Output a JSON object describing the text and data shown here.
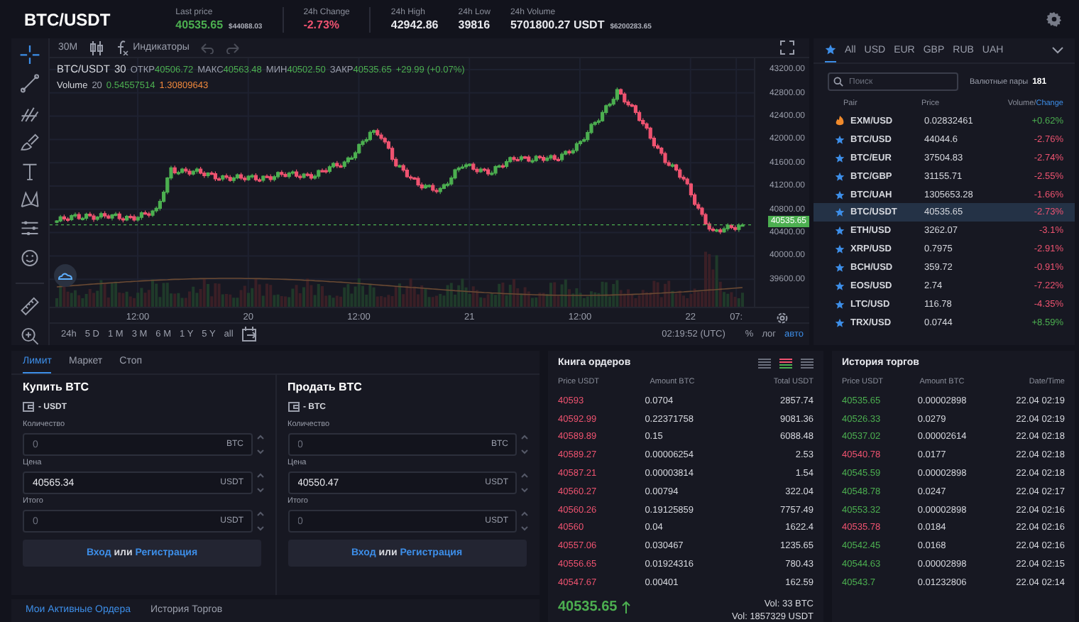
{
  "header": {
    "title": "BTC/USDT",
    "stats": [
      {
        "label": "Last price",
        "value": "40535.65",
        "color": "#4caf50",
        "sub": "$44088.03"
      },
      {
        "label": "24h Change",
        "value": "-2.73%",
        "color": "#ef5370"
      },
      {
        "label": "24h High",
        "value": "42942.86",
        "color": "#e8e9ee"
      },
      {
        "label": "24h Low",
        "value": "39816",
        "color": "#e8e9ee"
      },
      {
        "label": "24h Volume",
        "value": "5701800.27 USDT",
        "color": "#e8e9ee",
        "sub": "$6200283.65"
      }
    ]
  },
  "chart": {
    "interval": "30M",
    "indicators_label": "Индикаторы",
    "legend": {
      "symbol": "BTC/USDT",
      "interval": "30",
      "ohlc": [
        {
          "label": "ОТКР",
          "value": "40506.72"
        },
        {
          "label": "МАКС",
          "value": "40563.48"
        },
        {
          "label": "МИН",
          "value": "40502.50"
        },
        {
          "label": "ЗАКР",
          "value": "40535.65"
        }
      ],
      "change": "+29.99 (+0.07%)"
    },
    "volume_legend": {
      "label": "Volume",
      "period": "20",
      "value": "0.54557514",
      "average": "1.30809643"
    },
    "y_axis": [
      "43200.00",
      "42800.00",
      "42400.00",
      "42000.00",
      "41600.00",
      "41200.00",
      "40800.00",
      "40400.00",
      "40000.00",
      "39600.00"
    ],
    "price_tag": "40535.65",
    "x_axis": [
      "12:00",
      "20",
      "12:00",
      "21",
      "12:00",
      "22",
      "07:"
    ],
    "ranges": [
      "24h",
      "5 D",
      "1 M",
      "3 M",
      "6 M",
      "1 Y",
      "5 Y",
      "all"
    ],
    "clock": "02:19:52 (UTC)",
    "scale_options": [
      {
        "label": "%",
        "selected": false
      },
      {
        "label": "лог",
        "selected": false
      },
      {
        "label": "авто",
        "selected": true
      }
    ]
  },
  "market": {
    "tabs": [
      {
        "kind": "star",
        "selected": true
      },
      {
        "kind": "text",
        "label": "All",
        "selected": false
      },
      {
        "kind": "text",
        "label": "USD",
        "selected": false
      },
      {
        "kind": "text",
        "label": "EUR",
        "selected": false
      },
      {
        "kind": "text",
        "label": "GBP",
        "selected": false
      },
      {
        "kind": "text",
        "label": "RUB",
        "selected": false
      },
      {
        "kind": "text",
        "label": "UAH",
        "selected": false
      }
    ],
    "search": {
      "placeholder": "Поиск"
    },
    "pairs_label": "Валютные пары",
    "pairs_count": "181",
    "columns": {
      "pair": "Pair",
      "price": "Price",
      "volume": "Volume/",
      "change": "Change"
    },
    "rows": [
      {
        "kind": "hot",
        "pair": "EXM/USD",
        "price": "0.02832461",
        "change": "+0.62%",
        "color": "#4caf50",
        "selected": false
      },
      {
        "kind": "favorite",
        "pair": "BTC/USD",
        "price": "44044.6",
        "change": "-2.76%",
        "color": "#ef5370",
        "selected": false
      },
      {
        "kind": "favorite",
        "pair": "BTC/EUR",
        "price": "37504.83",
        "change": "-2.74%",
        "color": "#ef5370",
        "selected": false
      },
      {
        "kind": "favorite",
        "pair": "BTC/GBP",
        "price": "31155.71",
        "change": "-2.55%",
        "color": "#ef5370",
        "selected": false
      },
      {
        "kind": "favorite",
        "pair": "BTC/UAH",
        "price": "1305653.28",
        "change": "-1.66%",
        "color": "#ef5370",
        "selected": false
      },
      {
        "kind": "favorite",
        "pair": "BTC/USDT",
        "price": "40535.65",
        "change": "-2.73%",
        "color": "#ef5370",
        "selected": true
      },
      {
        "kind": "favorite",
        "pair": "ETH/USD",
        "price": "3262.07",
        "change": "-3.1%",
        "color": "#ef5370",
        "selected": false
      },
      {
        "kind": "favorite",
        "pair": "XRP/USD",
        "price": "0.7975",
        "change": "-2.91%",
        "color": "#ef5370",
        "selected": false
      },
      {
        "kind": "favorite",
        "pair": "BCH/USD",
        "price": "359.72",
        "change": "-0.91%",
        "color": "#ef5370",
        "selected": false
      },
      {
        "kind": "favorite",
        "pair": "EOS/USD",
        "price": "2.74",
        "change": "-7.22%",
        "color": "#ef5370",
        "selected": false
      },
      {
        "kind": "favorite",
        "pair": "LTC/USD",
        "price": "116.78",
        "change": "-4.35%",
        "color": "#ef5370",
        "selected": false
      },
      {
        "kind": "favorite",
        "pair": "TRX/USD",
        "price": "0.0744",
        "change": "+8.59%",
        "color": "#4caf50",
        "selected": false
      }
    ]
  },
  "order_form": {
    "tabs": [
      {
        "label": "Лимит",
        "selected": true
      },
      {
        "label": "Маркет",
        "selected": false
      },
      {
        "label": "Стоп",
        "selected": false
      }
    ],
    "sides": [
      {
        "title": "Купить BTC",
        "balance": "- USDT",
        "fields": [
          {
            "label": "Количество",
            "placeholder": "0",
            "unit": "BTC"
          },
          {
            "label": "Цена",
            "value": "40565.34",
            "unit": "USDT"
          },
          {
            "label": "Итого",
            "placeholder": "0",
            "unit": "USDT"
          }
        ],
        "button": {
          "login": "Вход",
          "joiner": "или",
          "register": "Регистрация"
        }
      },
      {
        "title": "Продать BTC",
        "balance": "- BTC",
        "fields": [
          {
            "label": "Количество",
            "placeholder": "0",
            "unit": "BTC"
          },
          {
            "label": "Цена",
            "value": "40550.47",
            "unit": "USDT"
          },
          {
            "label": "Итого",
            "placeholder": "0",
            "unit": "USDT"
          }
        ],
        "button": {
          "login": "Вход",
          "joiner": "или",
          "register": "Регистрация"
        }
      }
    ]
  },
  "bottom_tabs": [
    {
      "label": "Мои Активные Ордера",
      "selected": true
    },
    {
      "label": "История Торгов",
      "selected": false
    }
  ],
  "order_book": {
    "title": "Книга ордеров",
    "views": [
      {
        "kind": "bids",
        "selected": false
      },
      {
        "kind": "both",
        "selected": true
      },
      {
        "kind": "asks",
        "selected": false
      }
    ],
    "columns": [
      "Price USDT",
      "Amount BTC",
      "Total USDT"
    ],
    "rows": [
      {
        "color": "#ef5370",
        "price": "40593",
        "amount": "0.0704",
        "total": "2857.74"
      },
      {
        "color": "#ef5370",
        "price": "40592.99",
        "amount": "0.22371758",
        "total": "9081.36"
      },
      {
        "color": "#ef5370",
        "price": "40589.89",
        "amount": "0.15",
        "total": "6088.48"
      },
      {
        "color": "#ef5370",
        "price": "40589.27",
        "amount": "0.00006254",
        "total": "2.53"
      },
      {
        "color": "#ef5370",
        "price": "40587.21",
        "amount": "0.00003814",
        "total": "1.54"
      },
      {
        "color": "#ef5370",
        "price": "40560.27",
        "amount": "0.00794",
        "total": "322.04"
      },
      {
        "color": "#ef5370",
        "price": "40560.26",
        "amount": "0.19125859",
        "total": "7757.49"
      },
      {
        "color": "#ef5370",
        "price": "40560",
        "amount": "0.04",
        "total": "1622.4"
      },
      {
        "color": "#ef5370",
        "price": "40557.06",
        "amount": "0.030467",
        "total": "1235.65"
      },
      {
        "color": "#ef5370",
        "price": "40556.65",
        "amount": "0.01924316",
        "total": "780.43"
      },
      {
        "color": "#ef5370",
        "price": "40547.67",
        "amount": "0.00401",
        "total": "162.59"
      }
    ],
    "last_price": "40535.65",
    "volume_base": "Vol: 33 BTC",
    "volume_quote": "Vol: 1857329 USDT"
  },
  "trade_history": {
    "title": "История торгов",
    "columns": [
      "Price USDT",
      "Amount BTC",
      "Date/Time"
    ],
    "rows": [
      {
        "color": "#4caf50",
        "price": "40535.65",
        "amount": "0.00002898",
        "time": "22.04 02:19"
      },
      {
        "color": "#4caf50",
        "price": "40526.33",
        "amount": "0.0279",
        "time": "22.04 02:19"
      },
      {
        "color": "#4caf50",
        "price": "40537.02",
        "amount": "0.00002614",
        "time": "22.04 02:18"
      },
      {
        "color": "#ef5370",
        "price": "40540.78",
        "amount": "0.0177",
        "time": "22.04 02:18"
      },
      {
        "color": "#4caf50",
        "price": "40545.59",
        "amount": "0.00002898",
        "time": "22.04 02:18"
      },
      {
        "color": "#4caf50",
        "price": "40548.78",
        "amount": "0.0247",
        "time": "22.04 02:17"
      },
      {
        "color": "#4caf50",
        "price": "40553.32",
        "amount": "0.00002898",
        "time": "22.04 02:16"
      },
      {
        "color": "#ef5370",
        "price": "40535.78",
        "amount": "0.0184",
        "time": "22.04 02:16"
      },
      {
        "color": "#4caf50",
        "price": "40542.45",
        "amount": "0.0168",
        "time": "22.04 02:16"
      },
      {
        "color": "#4caf50",
        "price": "40544.63",
        "amount": "0.00002898",
        "time": "22.04 02:15"
      },
      {
        "color": "#4caf50",
        "price": "40543.7",
        "amount": "0.01232806",
        "time": "22.04 02:14"
      }
    ]
  }
}
